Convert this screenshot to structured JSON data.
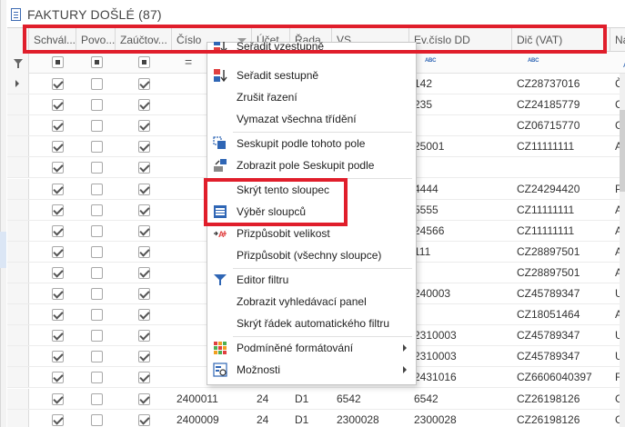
{
  "window": {
    "title": "FAKTURY DOŠLÉ (87)"
  },
  "grid": {
    "columns": [
      {
        "label": "Schvál...",
        "kind": "check"
      },
      {
        "label": "Povo...",
        "kind": "check"
      },
      {
        "label": "Zaúčtov...",
        "kind": "check"
      },
      {
        "label": "Číslo",
        "kind": "text"
      },
      {
        "label": "Účet",
        "kind": "text"
      },
      {
        "label": "Řada",
        "kind": "text"
      },
      {
        "label": "VS",
        "kind": "text"
      },
      {
        "label": "Ev.číslo DD",
        "kind": "text"
      },
      {
        "label": "Dič (VAT)",
        "kind": "text"
      },
      {
        "label": "Ná",
        "kind": "text"
      }
    ],
    "filter_row": {
      "equals_symbol": "=",
      "abc_label": "ABC"
    },
    "rows": [
      {
        "c1": true,
        "c2": false,
        "c3": true,
        "cislo": "",
        "ucet": "",
        "rada": "",
        "vs": "",
        "ev": "142",
        "dic": "CZ28737016",
        "na": "Če"
      },
      {
        "c1": true,
        "c2": false,
        "c3": true,
        "cislo": "",
        "ucet": "",
        "rada": "",
        "vs": "",
        "ev": "235",
        "dic": "CZ24185779",
        "na": "CY"
      },
      {
        "c1": true,
        "c2": false,
        "c3": true,
        "cislo": "",
        "ucet": "",
        "rada": "",
        "vs": "",
        "ev": "",
        "dic": "CZ06715770",
        "na": "GA"
      },
      {
        "c1": true,
        "c2": false,
        "c3": true,
        "cislo": "",
        "ucet": "",
        "rada": "",
        "vs": "",
        "ev": "25001",
        "dic": "CZ11111111",
        "na": "AP"
      },
      {
        "c1": true,
        "c2": false,
        "c3": true,
        "cislo": "",
        "ucet": "",
        "rada": "",
        "vs": "",
        "ev": "",
        "dic": "",
        "na": ""
      },
      {
        "c1": true,
        "c2": false,
        "c3": true,
        "cislo": "",
        "ucet": "",
        "rada": "",
        "vs": "",
        "ev": "4444",
        "dic": "CZ24294420",
        "na": "PE"
      },
      {
        "c1": true,
        "c2": false,
        "c3": true,
        "cislo": "",
        "ucet": "",
        "rada": "",
        "vs": "",
        "ev": "5555",
        "dic": "CZ11111111",
        "na": "AP"
      },
      {
        "c1": true,
        "c2": false,
        "c3": true,
        "cislo": "",
        "ucet": "",
        "rada": "",
        "vs": "",
        "ev": "24566",
        "dic": "CZ11111111",
        "na": "AP"
      },
      {
        "c1": true,
        "c2": false,
        "c3": true,
        "cislo": "",
        "ucet": "",
        "rada": "",
        "vs": "",
        "ev": "111",
        "dic": "CZ28897501",
        "na": "Ap"
      },
      {
        "c1": true,
        "c2": false,
        "c3": true,
        "cislo": "",
        "ucet": "",
        "rada": "",
        "vs": "",
        "ev": "",
        "dic": "CZ28897501",
        "na": "Ap"
      },
      {
        "c1": true,
        "c2": false,
        "c3": true,
        "cislo": "",
        "ucet": "",
        "rada": "",
        "vs": "",
        "ev": "240003",
        "dic": "CZ45789347",
        "na": "UN"
      },
      {
        "c1": true,
        "c2": false,
        "c3": true,
        "cislo": "",
        "ucet": "",
        "rada": "",
        "vs": "",
        "ev": "",
        "dic": "CZ18051464",
        "na": "AP"
      },
      {
        "c1": true,
        "c2": false,
        "c3": true,
        "cislo": "",
        "ucet": "",
        "rada": "",
        "vs": "",
        "ev": "2310003",
        "dic": "CZ45789347",
        "na": "UN"
      },
      {
        "c1": true,
        "c2": false,
        "c3": true,
        "cislo": "",
        "ucet": "",
        "rada": "",
        "vs": "",
        "ev": "2310003",
        "dic": "CZ45789347",
        "na": "UN"
      },
      {
        "c1": true,
        "c2": false,
        "c3": true,
        "cislo": "",
        "ucet": "",
        "rada": "",
        "vs": "",
        "ev": "2431016",
        "dic": "CZ6606040397",
        "na": "Ric"
      },
      {
        "c1": true,
        "c2": false,
        "c3": true,
        "cislo": "2400011",
        "ucet": "24",
        "rada": "D1",
        "vs": "6542",
        "ev": "6542",
        "dic": "CZ26198126",
        "na": "GA"
      },
      {
        "c1": true,
        "c2": false,
        "c3": true,
        "cislo": "2400009",
        "ucet": "24",
        "rada": "D1",
        "vs": "2300028",
        "ev": "2300028",
        "dic": "CZ26198126",
        "na": "GA"
      }
    ]
  },
  "context_menu": {
    "items": [
      {
        "label": "Seřadit vzestupně",
        "icon": "sort-ascending-icon",
        "sep_before": false,
        "submenu": false
      },
      {
        "label": "Seřadit sestupně",
        "icon": "sort-descending-icon",
        "sep_before": false,
        "submenu": false
      },
      {
        "label": "Zrušit řazení",
        "icon": "",
        "sep_before": false,
        "submenu": false
      },
      {
        "label": "Vymazat všechna třídění",
        "icon": "",
        "sep_before": false,
        "submenu": false
      },
      {
        "label": "Seskupit podle tohoto pole",
        "icon": "group-by-icon",
        "sep_before": true,
        "submenu": false
      },
      {
        "label": "Zobrazit pole Seskupit podle",
        "icon": "group-panel-icon",
        "sep_before": false,
        "submenu": false
      },
      {
        "label": "Skrýt tento sloupec",
        "icon": "",
        "sep_before": true,
        "submenu": false
      },
      {
        "label": "Výběr sloupců",
        "icon": "column-chooser-icon",
        "sep_before": false,
        "submenu": false
      },
      {
        "label": "Přizpůsobit velikost",
        "icon": "best-fit-icon",
        "sep_before": false,
        "submenu": false
      },
      {
        "label": "Přizpůsobit (všechny sloupce)",
        "icon": "",
        "sep_before": false,
        "submenu": false
      },
      {
        "label": "Editor filtru",
        "icon": "filter-icon",
        "sep_before": true,
        "submenu": false
      },
      {
        "label": "Zobrazit vyhledávací panel",
        "icon": "",
        "sep_before": false,
        "submenu": false
      },
      {
        "label": "Skrýt řádek automatického filtru",
        "icon": "",
        "sep_before": false,
        "submenu": false
      },
      {
        "label": "Podmíněné formátování",
        "icon": "conditional-format-icon",
        "sep_before": true,
        "submenu": true
      },
      {
        "label": "Možnosti",
        "icon": "options-icon",
        "sep_before": false,
        "submenu": true
      }
    ]
  },
  "colors": {
    "highlight_red": "#e01e2b",
    "accent_blue": "#2f66b5"
  }
}
